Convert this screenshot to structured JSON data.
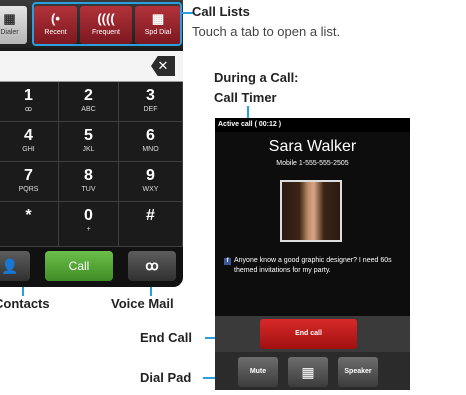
{
  "dialer": {
    "tabs": [
      {
        "label": "Dialer",
        "icon": "▦"
      },
      {
        "label": "Recent",
        "icon": "(•"
      },
      {
        "label": "Frequent",
        "icon": "(((("
      },
      {
        "label": "Spd Dial",
        "icon": "▦"
      }
    ],
    "backspace_icon": "✕",
    "keys": [
      {
        "digit": "1",
        "letters": "ꝏ"
      },
      {
        "digit": "2",
        "letters": "ABC"
      },
      {
        "digit": "3",
        "letters": "DEF"
      },
      {
        "digit": "4",
        "letters": "GHI"
      },
      {
        "digit": "5",
        "letters": "JKL"
      },
      {
        "digit": "6",
        "letters": "MNO"
      },
      {
        "digit": "7",
        "letters": "PQRS"
      },
      {
        "digit": "8",
        "letters": "TUV"
      },
      {
        "digit": "9",
        "letters": "WXY"
      },
      {
        "digit": "*",
        "letters": ""
      },
      {
        "digit": "0",
        "letters": "+"
      },
      {
        "digit": "#",
        "letters": ""
      }
    ],
    "contacts_icon": "👤",
    "call_label": "Call",
    "voicemail_icon": "ꝏ"
  },
  "callouts": {
    "call_lists_title": "Call Lists",
    "call_lists_desc": "Touch a tab to open a list.",
    "during_call": "During a Call:",
    "call_timer": "Call Timer",
    "contacts": "Contacts",
    "voice_mail": "Voice Mail",
    "end_call": "End Call",
    "dial_pad": "Dial Pad"
  },
  "active_call": {
    "status": "Active call ( 00:12 )",
    "caller_name": "Sara Walker",
    "caller_number": "Mobile 1-555-555-2505",
    "social_icon": "f",
    "status_text": "Anyone know a good graphic designer? I need 60s themed invitations for my party.",
    "end_call_label": "End call",
    "mute_label": "Mute",
    "dialpad_icon": "▦",
    "speaker_label": "Speaker"
  },
  "colors": {
    "accent": "#2a9fe0",
    "call_green": "#4fa22f",
    "end_red": "#c11a1a",
    "tab_red": "#98242c"
  }
}
